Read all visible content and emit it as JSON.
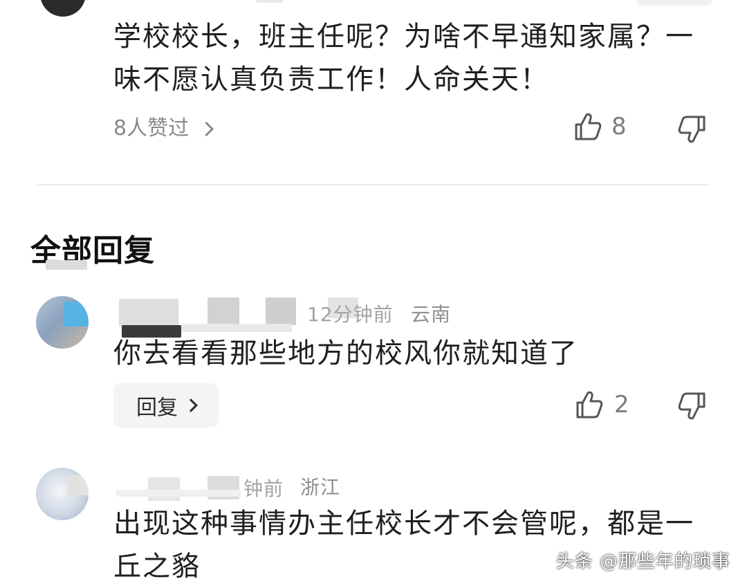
{
  "top_comment": {
    "text": "学校校长，班主任呢？为啥不早通知家属？一味不愿认真负责工作！人命关天！",
    "liked_by": "8人赞过",
    "like_count": "8"
  },
  "section_title": "全部回复",
  "replies": [
    {
      "time_fragment": "12分钟前",
      "location": "云南",
      "text": "你去看看那些地方的校风你就知道了",
      "reply_label": "回复",
      "like_count": "2"
    },
    {
      "time_fragment": "钟前",
      "location": "浙江",
      "text": "出现这种事情办主任校长才不会管呢，都是一丘之貉"
    }
  ],
  "watermark": "头条 @那些年的琐事",
  "icons": {
    "like": "thumbs-up-icon",
    "dislike": "thumbs-down-icon",
    "chevron": "chevron-right-icon"
  },
  "colors": {
    "text": "#1f1f1f",
    "muted": "#8a8a8a",
    "reply_button_bg": "#f4f4f4",
    "divider": "#ececec"
  }
}
